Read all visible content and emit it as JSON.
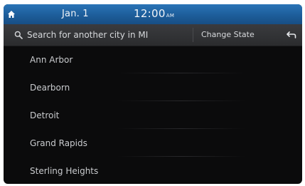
{
  "status_bar": {
    "home_icon": "home-icon",
    "date": "Jan. 1",
    "time": "12:00",
    "ampm": "AM"
  },
  "search": {
    "icon": "search-icon",
    "placeholder": "Search for another city in MI",
    "change_state_label": "Change State",
    "back_icon": "back-arrow-icon"
  },
  "cities": [
    {
      "name": "Ann Arbor"
    },
    {
      "name": "Dearborn"
    },
    {
      "name": "Detroit"
    },
    {
      "name": "Grand Rapids"
    },
    {
      "name": "Sterling Heights"
    }
  ],
  "colors": {
    "status_bar": "#1f63a3",
    "background": "#0b0b0c",
    "search_bar": "#333436"
  }
}
